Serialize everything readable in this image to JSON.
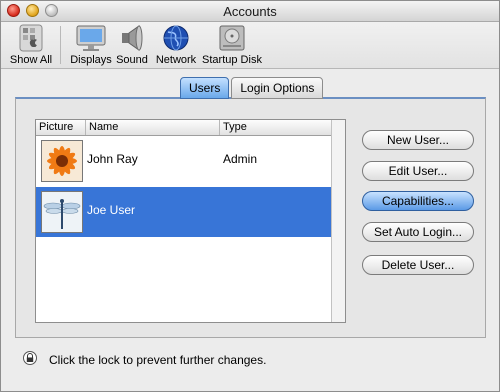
{
  "window": {
    "title": "Accounts"
  },
  "toolbar": {
    "items": [
      {
        "label": "Show All",
        "icon": "apple-grid-icon"
      },
      {
        "label": "Displays",
        "icon": "monitor-icon"
      },
      {
        "label": "Sound",
        "icon": "speaker-icon"
      },
      {
        "label": "Network",
        "icon": "globe-icon"
      },
      {
        "label": "Startup Disk",
        "icon": "hard-disk-icon"
      }
    ]
  },
  "tabs": [
    {
      "label": "Users",
      "active": true
    },
    {
      "label": "Login Options",
      "active": false
    }
  ],
  "list": {
    "columns": [
      "Picture",
      "Name",
      "Type"
    ],
    "rows": [
      {
        "name": "John Ray",
        "type": "Admin",
        "picture": "flower-picture",
        "selected": false
      },
      {
        "name": "Joe User",
        "type": "",
        "picture": "dragonfly-picture",
        "selected": true
      }
    ]
  },
  "buttons": {
    "new_user": "New User...",
    "edit_user": "Edit User...",
    "capabilities": "Capabilities...",
    "set_auto_login": "Set Auto Login...",
    "delete_user": "Delete User..."
  },
  "footer": {
    "lock_text": "Click the lock to prevent further changes."
  },
  "colors": {
    "selection": "#3875d7",
    "accent": "#6aa8ea"
  }
}
